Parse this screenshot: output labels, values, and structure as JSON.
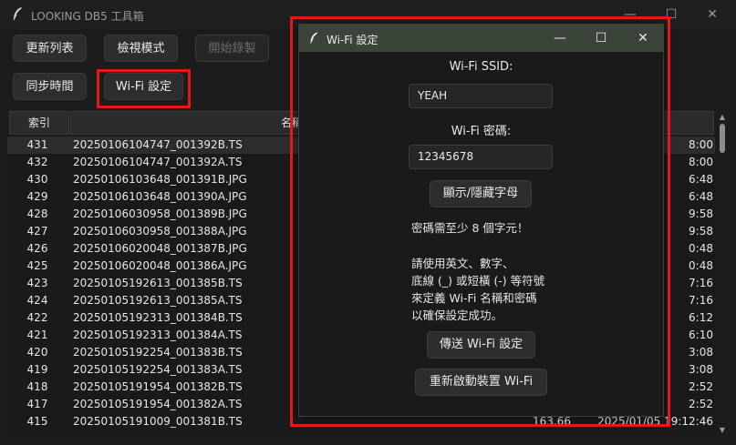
{
  "app": {
    "title": "LOOKING DB5 工具箱"
  },
  "toolbar": {
    "refresh_label": "更新列表",
    "view_mode_label": "檢視模式",
    "start_record_label": "開始錄製",
    "sync_time_label": "同步時間",
    "wifi_settings_label": "Wi-Fi 設定"
  },
  "table": {
    "headers": {
      "index": "索引",
      "name": "名稱"
    },
    "rows": [
      {
        "index": "431",
        "name": "20250106104747_001392B.TS",
        "size": "",
        "date": "8:00"
      },
      {
        "index": "432",
        "name": "20250106104747_001392A.TS",
        "size": "",
        "date": "8:00"
      },
      {
        "index": "430",
        "name": "20250106103648_001391B.JPG",
        "size": "",
        "date": "6:48"
      },
      {
        "index": "429",
        "name": "20250106103648_001390A.JPG",
        "size": "",
        "date": "6:48"
      },
      {
        "index": "428",
        "name": "20250106030958_001389B.JPG",
        "size": "",
        "date": "9:58"
      },
      {
        "index": "427",
        "name": "20250106030958_001388A.JPG",
        "size": "",
        "date": "9:58"
      },
      {
        "index": "426",
        "name": "20250106020048_001387B.JPG",
        "size": "",
        "date": "0:48"
      },
      {
        "index": "425",
        "name": "20250106020048_001386A.JPG",
        "size": "",
        "date": "0:48"
      },
      {
        "index": "423",
        "name": "20250105192613_001385B.TS",
        "size": "",
        "date": "7:16"
      },
      {
        "index": "424",
        "name": "20250105192613_001385A.TS",
        "size": "",
        "date": "7:16"
      },
      {
        "index": "422",
        "name": "20250105192313_001384B.TS",
        "size": "",
        "date": "6:12"
      },
      {
        "index": "421",
        "name": "20250105192313_001384A.TS",
        "size": "",
        "date": "6:10"
      },
      {
        "index": "420",
        "name": "20250105192254_001383B.TS",
        "size": "",
        "date": "3:08"
      },
      {
        "index": "419",
        "name": "20250105192254_001383A.TS",
        "size": "",
        "date": "3:08"
      },
      {
        "index": "418",
        "name": "20250105191954_001382B.TS",
        "size": "",
        "date": "2:52"
      },
      {
        "index": "417",
        "name": "20250105191954_001382A.TS",
        "size": "",
        "date": "2:52"
      },
      {
        "index": "415",
        "name": "20250105191009_001381B.TS",
        "size": "163.66",
        "date": "2025/01/05 19:12:46"
      }
    ]
  },
  "dialog": {
    "title": "Wi-Fi 設定",
    "ssid_label": "Wi-Fi SSID:",
    "ssid_value": "YEAH",
    "password_label": "Wi-Fi 密碼:",
    "password_value": "12345678",
    "toggle_label": "顯示/隱藏字母",
    "min_length_note": "密碼需至少 8 個字元！",
    "instruction_lines": [
      "請使用英文、數字、",
      "底線 (_) 或短橫 (-) 等符號",
      "來定義 Wi-Fi 名稱和密碼",
      "以確保設定成功。"
    ],
    "send_label": "傳送 Wi-Fi 設定",
    "restart_label": "重新啟動裝置 Wi-Fi"
  },
  "colors": {
    "highlight": "#e01919",
    "dialog_titlebar": "#3a4439",
    "background": "#1c1c1c"
  },
  "icons": [
    "feather-icon",
    "minimize-icon",
    "maximize-icon",
    "close-icon",
    "scroll-up-icon",
    "scroll-down-icon"
  ]
}
